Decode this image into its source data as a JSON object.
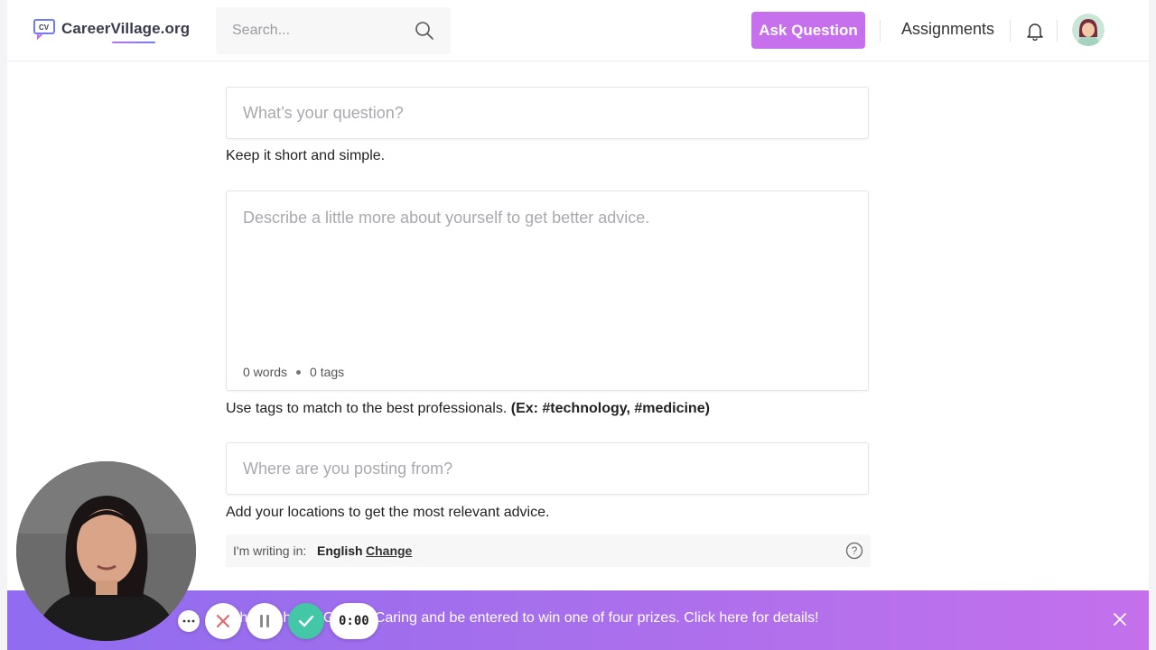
{
  "header": {
    "logo_text": "CareerVillage.org",
    "search_placeholder": "Search...",
    "ask_button": "Ask Question",
    "assignments": "Assignments"
  },
  "form": {
    "question_placeholder": "What’s your question?",
    "question_help": "Keep it short and simple.",
    "description_placeholder": "Describe a little more about yourself to get better advice.",
    "word_count": "0 words",
    "tag_count": "0 tags",
    "tags_help": "Use tags to match to the best professionals.",
    "tags_example": "(Ex: #technology, #medicine)",
    "location_placeholder": "Where are you posting from?",
    "location_help": "Add your locations to get the most relevant advice.",
    "language_label": "I'm writing in:",
    "language_value": "English",
    "language_change": "Change"
  },
  "banner": {
    "text": "Use the hashtag #GivingisCaring and be entered to win one of four prizes. Click here for details!"
  },
  "recorder": {
    "timer": "0:00"
  },
  "colors": {
    "accent": "#c770ee",
    "banner_start": "#8f6cf0",
    "banner_end": "#c470ec",
    "record_check": "#43c7a7"
  }
}
